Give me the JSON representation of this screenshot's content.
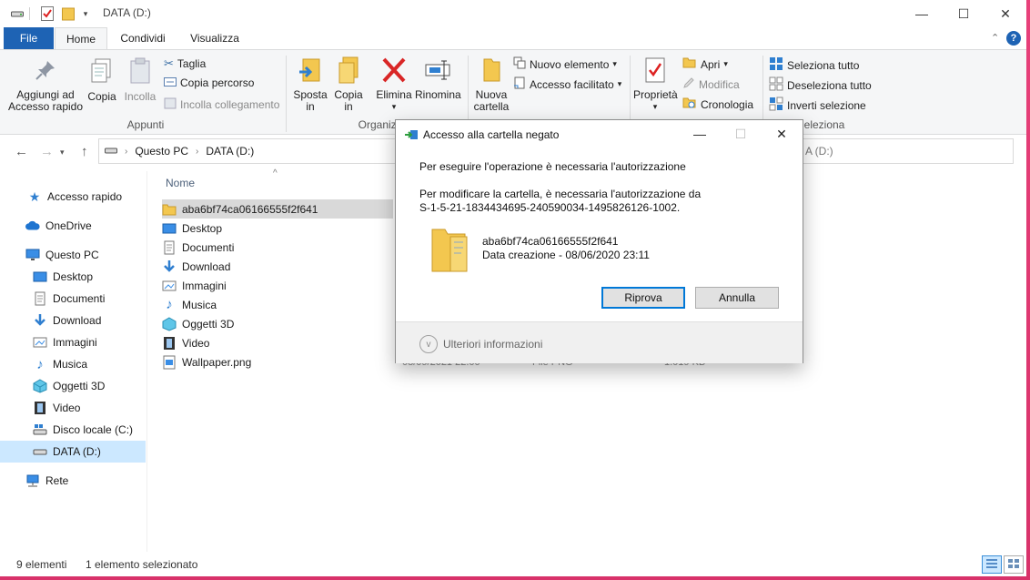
{
  "window": {
    "title": "DATA (D:)",
    "controls": {
      "minimize": "—",
      "maximize": "☐",
      "close": "✕"
    }
  },
  "tabs": [
    "File",
    "Home",
    "Condividi",
    "Visualizza"
  ],
  "ribbon": {
    "appunti": {
      "pin_line1": "Aggiungi ad",
      "pin_line2": "Accesso rapido",
      "copia": "Copia",
      "incolla": "Incolla",
      "taglia": "Taglia",
      "copia_percorso": "Copia percorso",
      "incolla_collegamento": "Incolla collegamento",
      "group": "Appunti"
    },
    "organizza": {
      "sposta_line1": "Sposta",
      "sposta_line2": "in",
      "copia_line1": "Copia",
      "copia_line2": "in",
      "elimina": "Elimina",
      "rinomina": "Rinomina",
      "group": "Organizza"
    },
    "nuovo": {
      "cartella_line1": "Nuova",
      "cartella_line2": "cartella",
      "nuovo_elemento": "Nuovo elemento",
      "accesso_facilitato": "Accesso facilitato"
    },
    "apri": {
      "proprieta": "Proprietà",
      "apri": "Apri",
      "modifica": "Modifica",
      "cronologia": "Cronologia"
    },
    "seleziona": {
      "seleziona_tutto": "Seleziona tutto",
      "deseleziona_tutto": "Deseleziona tutto",
      "inverti_selezione": "Inverti selezione",
      "group": "Seleziona"
    }
  },
  "address": {
    "crumbs": [
      "Questo PC",
      "DATA (D:)"
    ],
    "right_fragment": "A (D:)"
  },
  "sidebar": {
    "items": [
      {
        "label": "Accesso rapido"
      },
      {
        "label": "OneDrive"
      },
      {
        "label": "Questo PC"
      },
      {
        "label": "Desktop"
      },
      {
        "label": "Documenti"
      },
      {
        "label": "Download"
      },
      {
        "label": "Immagini"
      },
      {
        "label": "Musica"
      },
      {
        "label": "Oggetti 3D"
      },
      {
        "label": "Video"
      },
      {
        "label": "Disco locale (C:)"
      },
      {
        "label": "DATA (D:)"
      },
      {
        "label": "Rete"
      }
    ]
  },
  "filelist": {
    "header_name": "Nome",
    "items": [
      {
        "name": "aba6bf74ca06166555f2f641"
      },
      {
        "name": "Desktop"
      },
      {
        "name": "Documenti"
      },
      {
        "name": "Download"
      },
      {
        "name": "Immagini"
      },
      {
        "name": "Musica"
      },
      {
        "name": "Oggetti 3D"
      },
      {
        "name": "Video"
      },
      {
        "name": "Wallpaper.png"
      }
    ],
    "wallpaper_meta": {
      "date": "08/09/2021 22.00",
      "type": "File PNG",
      "size": "1.019 KB"
    }
  },
  "statusbar": {
    "count": "9 elementi",
    "selected": "1 elemento selezionato"
  },
  "dialog": {
    "title": "Accesso alla cartella negato",
    "line1": "Per eseguire l'operazione è necessaria l'autorizzazione",
    "line2": "Per modificare la cartella, è necessaria l'autorizzazione da",
    "line3": "S-1-5-21-1834434695-240590034-1495826126-1002.",
    "folder_name": "aba6bf74ca06166555f2f641",
    "folder_date": "Data creazione - 08/06/2020 23:11",
    "retry": "Riprova",
    "cancel": "Annulla",
    "more": "Ulteriori informazioni",
    "controls": {
      "minimize": "—",
      "maximize": "☐",
      "close": "✕"
    }
  },
  "colors": {
    "accent": "#1e63b4",
    "folder": "#f3c74f",
    "selection": "#cce8ff",
    "desktop_edge": "#e8407a"
  }
}
